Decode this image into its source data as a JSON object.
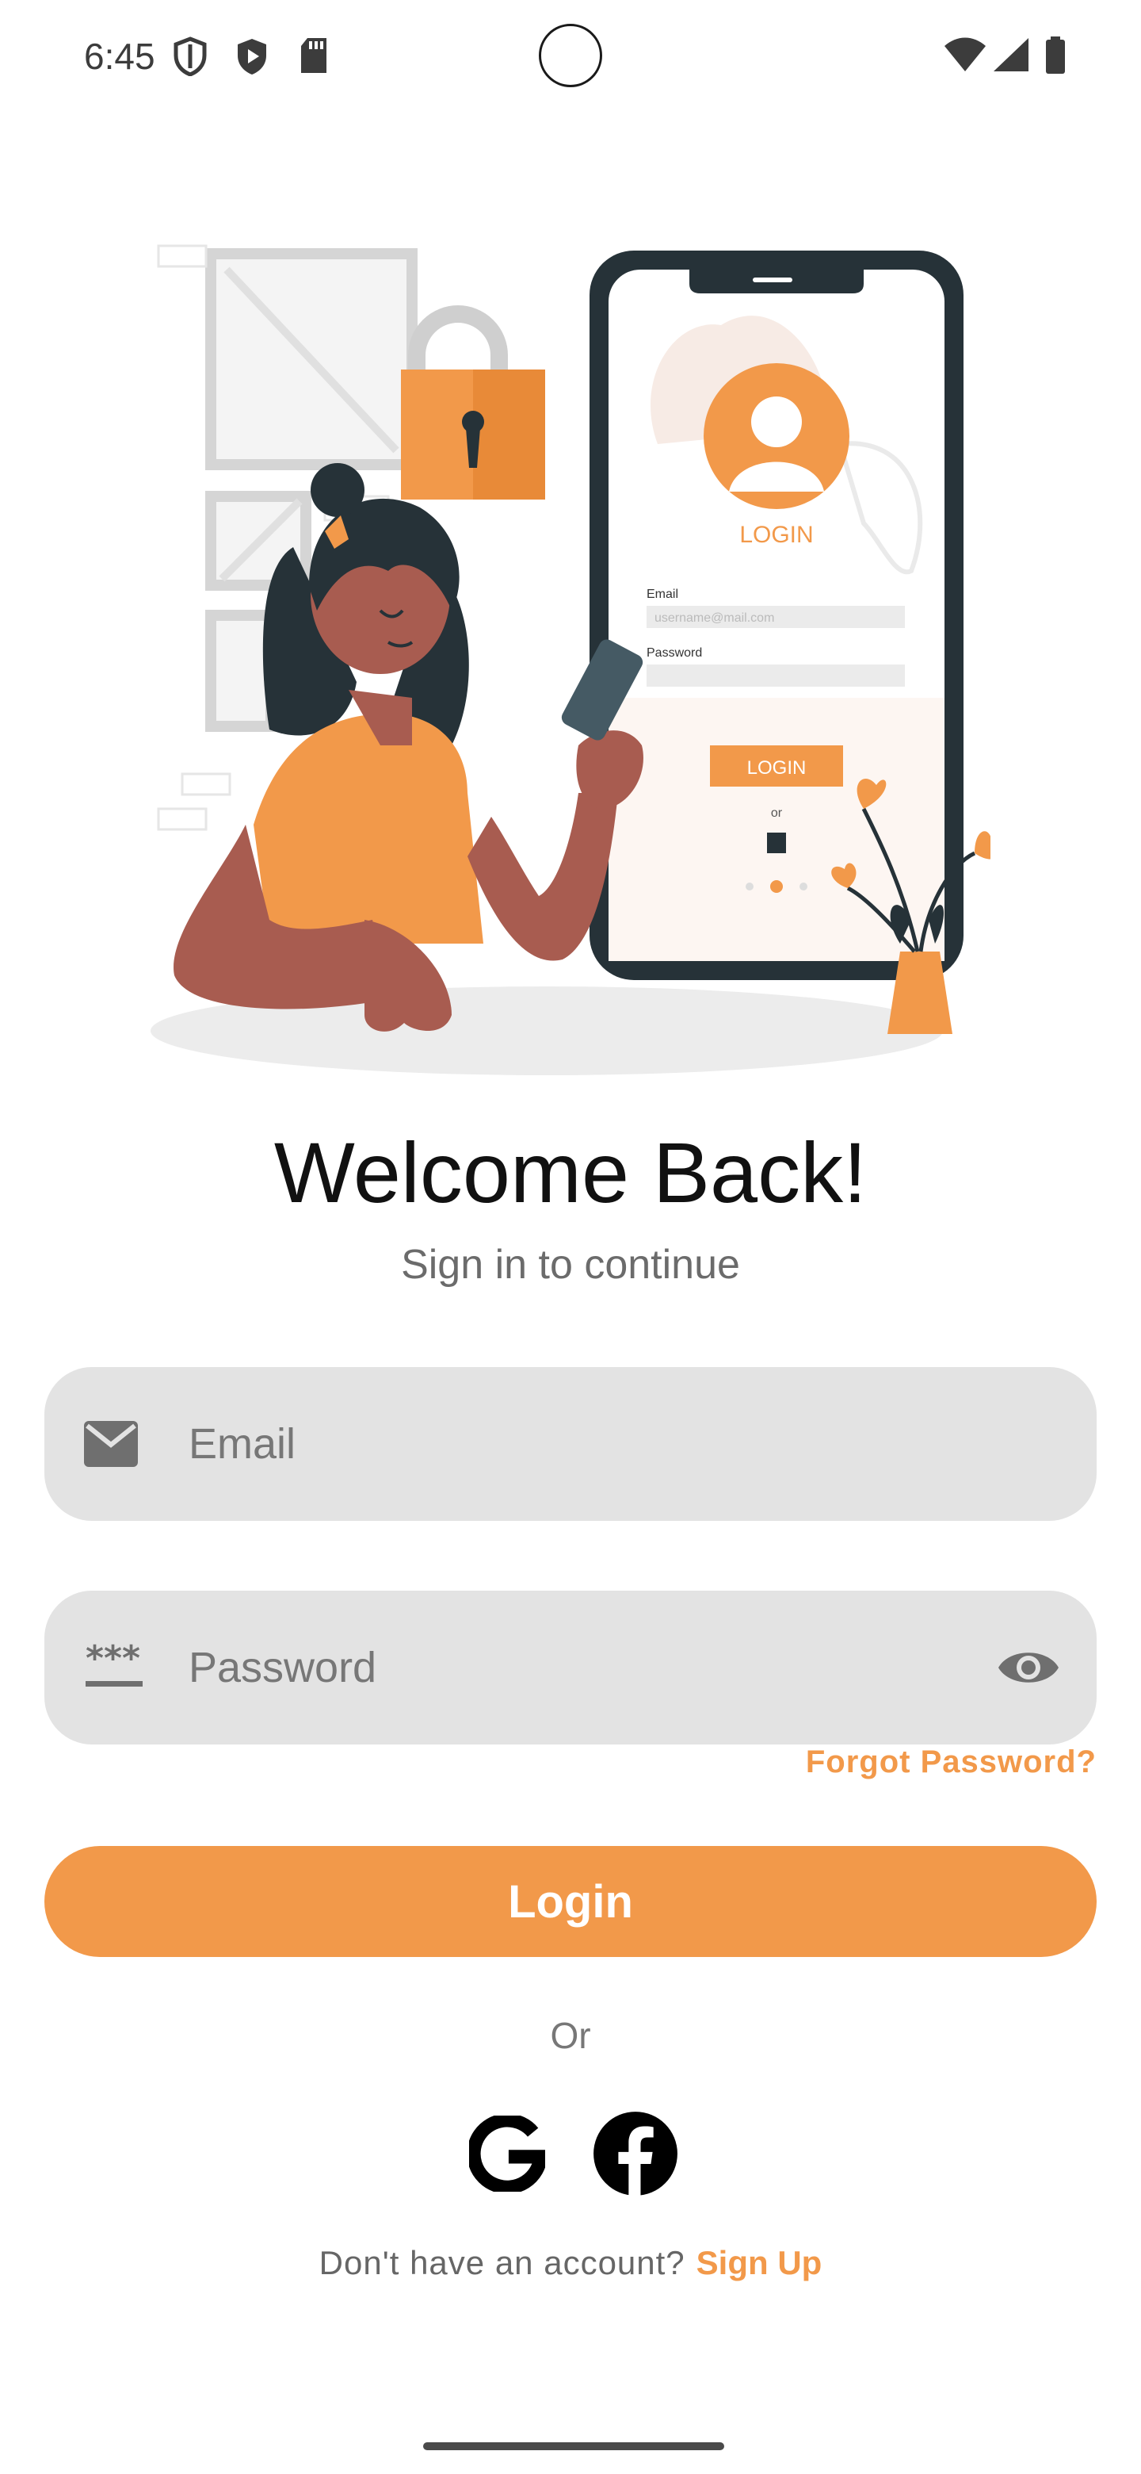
{
  "status_bar": {
    "time": "6:45",
    "icons": [
      "shield-icon",
      "play-protect-icon",
      "sd-card-icon",
      "wifi-icon",
      "cell-signal-icon",
      "battery-icon"
    ]
  },
  "illustration": {
    "screen_title": "LOGIN",
    "email_label": "Email",
    "email_placeholder": "username@mail.com",
    "password_label": "Password",
    "button_label": "LOGIN",
    "or_label": "or"
  },
  "header": {
    "title": "Welcome Back!",
    "subtitle": "Sign in to continue"
  },
  "form": {
    "email_placeholder": "Email",
    "password_placeholder": "Password",
    "forgot_label": "Forgot Password?",
    "login_label": "Login"
  },
  "social": {
    "or_label": "Or",
    "providers": [
      "google-icon",
      "facebook-icon"
    ]
  },
  "footer": {
    "prompt": "Don't have an account?",
    "signup_label": "Sign Up"
  },
  "colors": {
    "accent": "#f2994a",
    "field_background": "#e3e3e3",
    "skin": "#a85c50",
    "dark": "#263238"
  }
}
